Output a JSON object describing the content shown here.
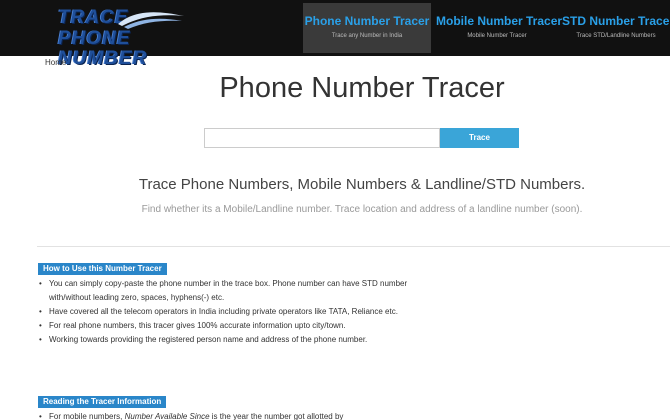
{
  "logo": {
    "line1": "TRACE",
    "line2": "PHONE NUMBER"
  },
  "nav": [
    {
      "title": "Phone Number Tracer",
      "sub": "Trace any Number in India"
    },
    {
      "title": "Mobile Number Tracer",
      "sub": "Mobile Number Tracer"
    },
    {
      "title": "STD Number Tracer",
      "sub": "Trace STD/Landline Numbers"
    }
  ],
  "breadcrumb": "Home",
  "title": "Phone Number Tracer",
  "search": {
    "value": "",
    "placeholder": "",
    "button": "Trace"
  },
  "tagline": "Trace Phone Numbers, Mobile Numbers & Landline/STD Numbers.",
  "subline": "Find whether its a Mobile/Landline number. Trace location and address of a landline number (soon).",
  "how_to": {
    "heading": "How to Use this Number Tracer",
    "items": [
      "You can simply copy-paste the phone number in the trace box. Phone number can have STD number with/without leading zero, spaces, hyphens(-) etc.",
      "Have covered all the telecom operators in India including private operators like TATA, Reliance etc.",
      "For real phone numbers, this tracer gives 100% accurate information upto city/town.",
      "Working towards providing the registered person name and address of the phone number."
    ]
  },
  "reading": {
    "heading": "Reading the Tracer Information",
    "partial_prefix": "For mobile numbers, ",
    "partial_em": "Number Available Since",
    "partial_suffix": " is the year the number got allotted by"
  },
  "colors": {
    "header_bg": "#111111",
    "nav_active_bg": "#3a3a3a",
    "nav_link": "#2aa0e8",
    "button": "#3aa5d8",
    "section_label": "#2a86c9"
  }
}
